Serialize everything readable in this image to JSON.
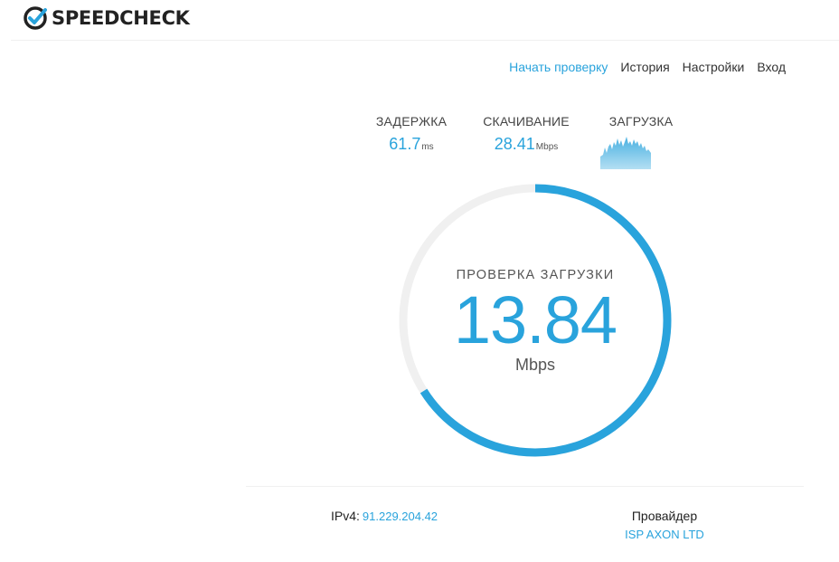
{
  "brand": {
    "name": "SPEEDCHECK"
  },
  "nav": {
    "start_test": "Начать проверку",
    "history": "История",
    "settings": "Настройки",
    "login": "Вход"
  },
  "stats": {
    "latency": {
      "label": "ЗАДЕРЖКА",
      "value": "61.7",
      "unit": "ms"
    },
    "download": {
      "label": "СКАЧИВАНИЕ",
      "value": "28.41",
      "unit": "Mbps"
    },
    "upload": {
      "label": "ЗАГРУЗКА"
    }
  },
  "gauge": {
    "title": "ПРОВЕРКА ЗАГРУЗКИ",
    "value": "13.84",
    "unit": "Mbps",
    "progress": 0.66
  },
  "footer": {
    "ip_label": "IPv4:",
    "ip_value": "91.229.204.42",
    "isp_label": "Провайдер",
    "isp_value": "ISP AXON LTD"
  },
  "colors": {
    "accent": "#29a3dc",
    "track": "#f0f0f0",
    "text": "#333333"
  },
  "icons": {
    "logo": "checkmark-circle-icon"
  }
}
